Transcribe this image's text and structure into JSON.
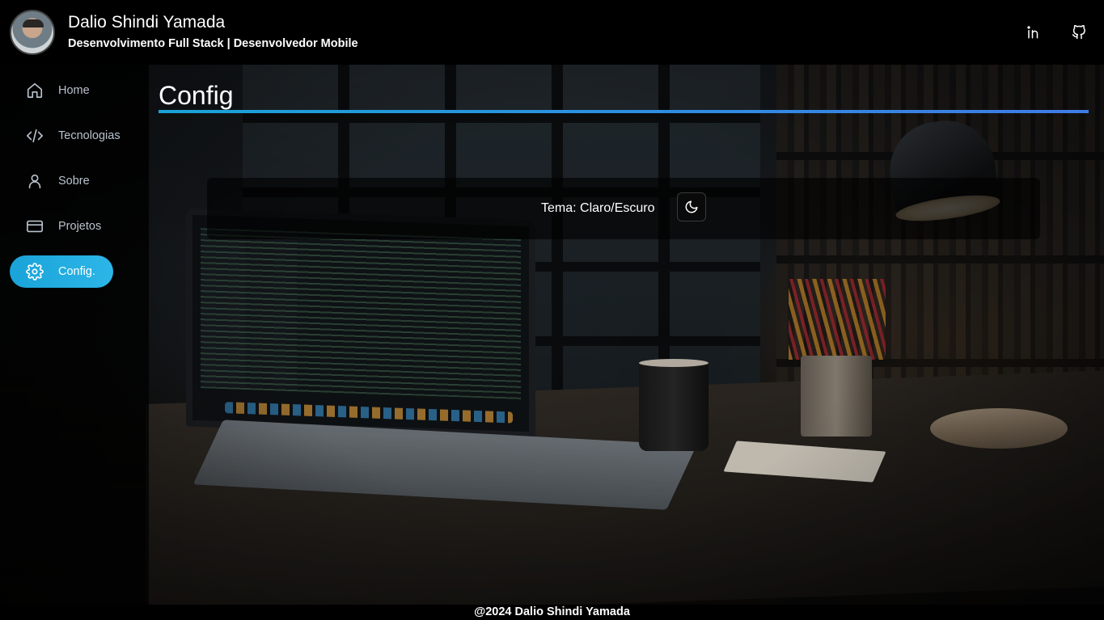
{
  "header": {
    "name": "Dalio Shindi Yamada",
    "subtitle": "Desenvolvimento Full Stack | Desenvolvedor Mobile",
    "avatar_icon": "profile-photo",
    "social": [
      {
        "icon": "linkedin-icon"
      },
      {
        "icon": "github-icon"
      }
    ]
  },
  "sidebar": {
    "items": [
      {
        "label": "Home",
        "icon": "home-icon",
        "active": false
      },
      {
        "label": "Tecnologias",
        "icon": "code-icon",
        "active": false
      },
      {
        "label": "Sobre",
        "icon": "user-icon",
        "active": false
      },
      {
        "label": "Projetos",
        "icon": "card-icon",
        "active": false
      },
      {
        "label": "Config.",
        "icon": "gear-icon",
        "active": true
      }
    ]
  },
  "main": {
    "title": "Config",
    "theme": {
      "label": "Tema: Claro/Escuro",
      "toggle_icon": "moon-icon"
    }
  },
  "footer": {
    "text": "@2024 Dalio Shindi Yamada"
  },
  "colors": {
    "accent": "#1aa3d8",
    "accent_gradient_end": "#3f7be6",
    "header_bg": "#000000",
    "text": "#ffffff",
    "nav_text": "#b8c2cc"
  }
}
